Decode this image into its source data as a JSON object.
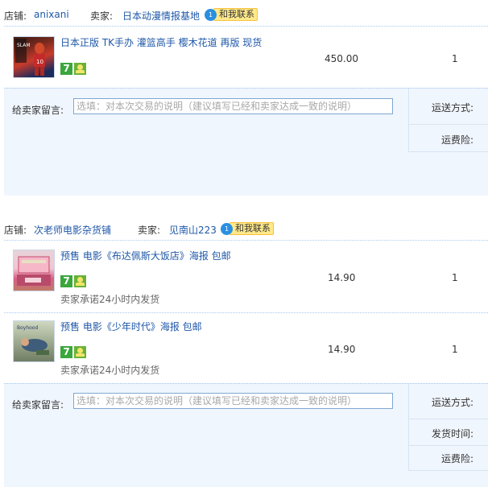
{
  "shop1": {
    "shop_label": "店铺:",
    "shop_name": "anixani",
    "seller_label": "卖家:",
    "seller_name": "日本动漫情报基地",
    "contact_text": "和我联系",
    "items": [
      {
        "title": "日本正版 TK手办 灌篮高手 樱木花道 再版 现货",
        "price": "450.00",
        "qty": "1"
      }
    ],
    "message_label": "给卖家留言:",
    "message_placeholder": "选填：对本次交易的说明（建议填写已经和卖家达成一致的说明）",
    "shipping_label": "运送方式:",
    "insurance_label": "运费险:"
  },
  "shop2": {
    "shop_label": "店铺:",
    "shop_name": "次老师电影杂货铺",
    "seller_label": "卖家:",
    "seller_name": "见南山223",
    "contact_text": "和我联系",
    "items": [
      {
        "title": "预售 电影《布达佩斯大饭店》海报 包邮",
        "price": "14.90",
        "qty": "1",
        "promise": "卖家承诺24小时内发货"
      },
      {
        "title": "预售 电影《少年时代》海报 包邮",
        "price": "14.90",
        "qty": "1",
        "promise": "卖家承诺24小时内发货"
      }
    ],
    "message_label": "给卖家留言:",
    "message_placeholder": "选填：对本次交易的说明（建议填写已经和卖家达成一致的说明）",
    "shipping_label": "运送方式:",
    "delivery_time_label": "发货时间:",
    "insurance_label": "运费险:"
  },
  "badge7": "7"
}
